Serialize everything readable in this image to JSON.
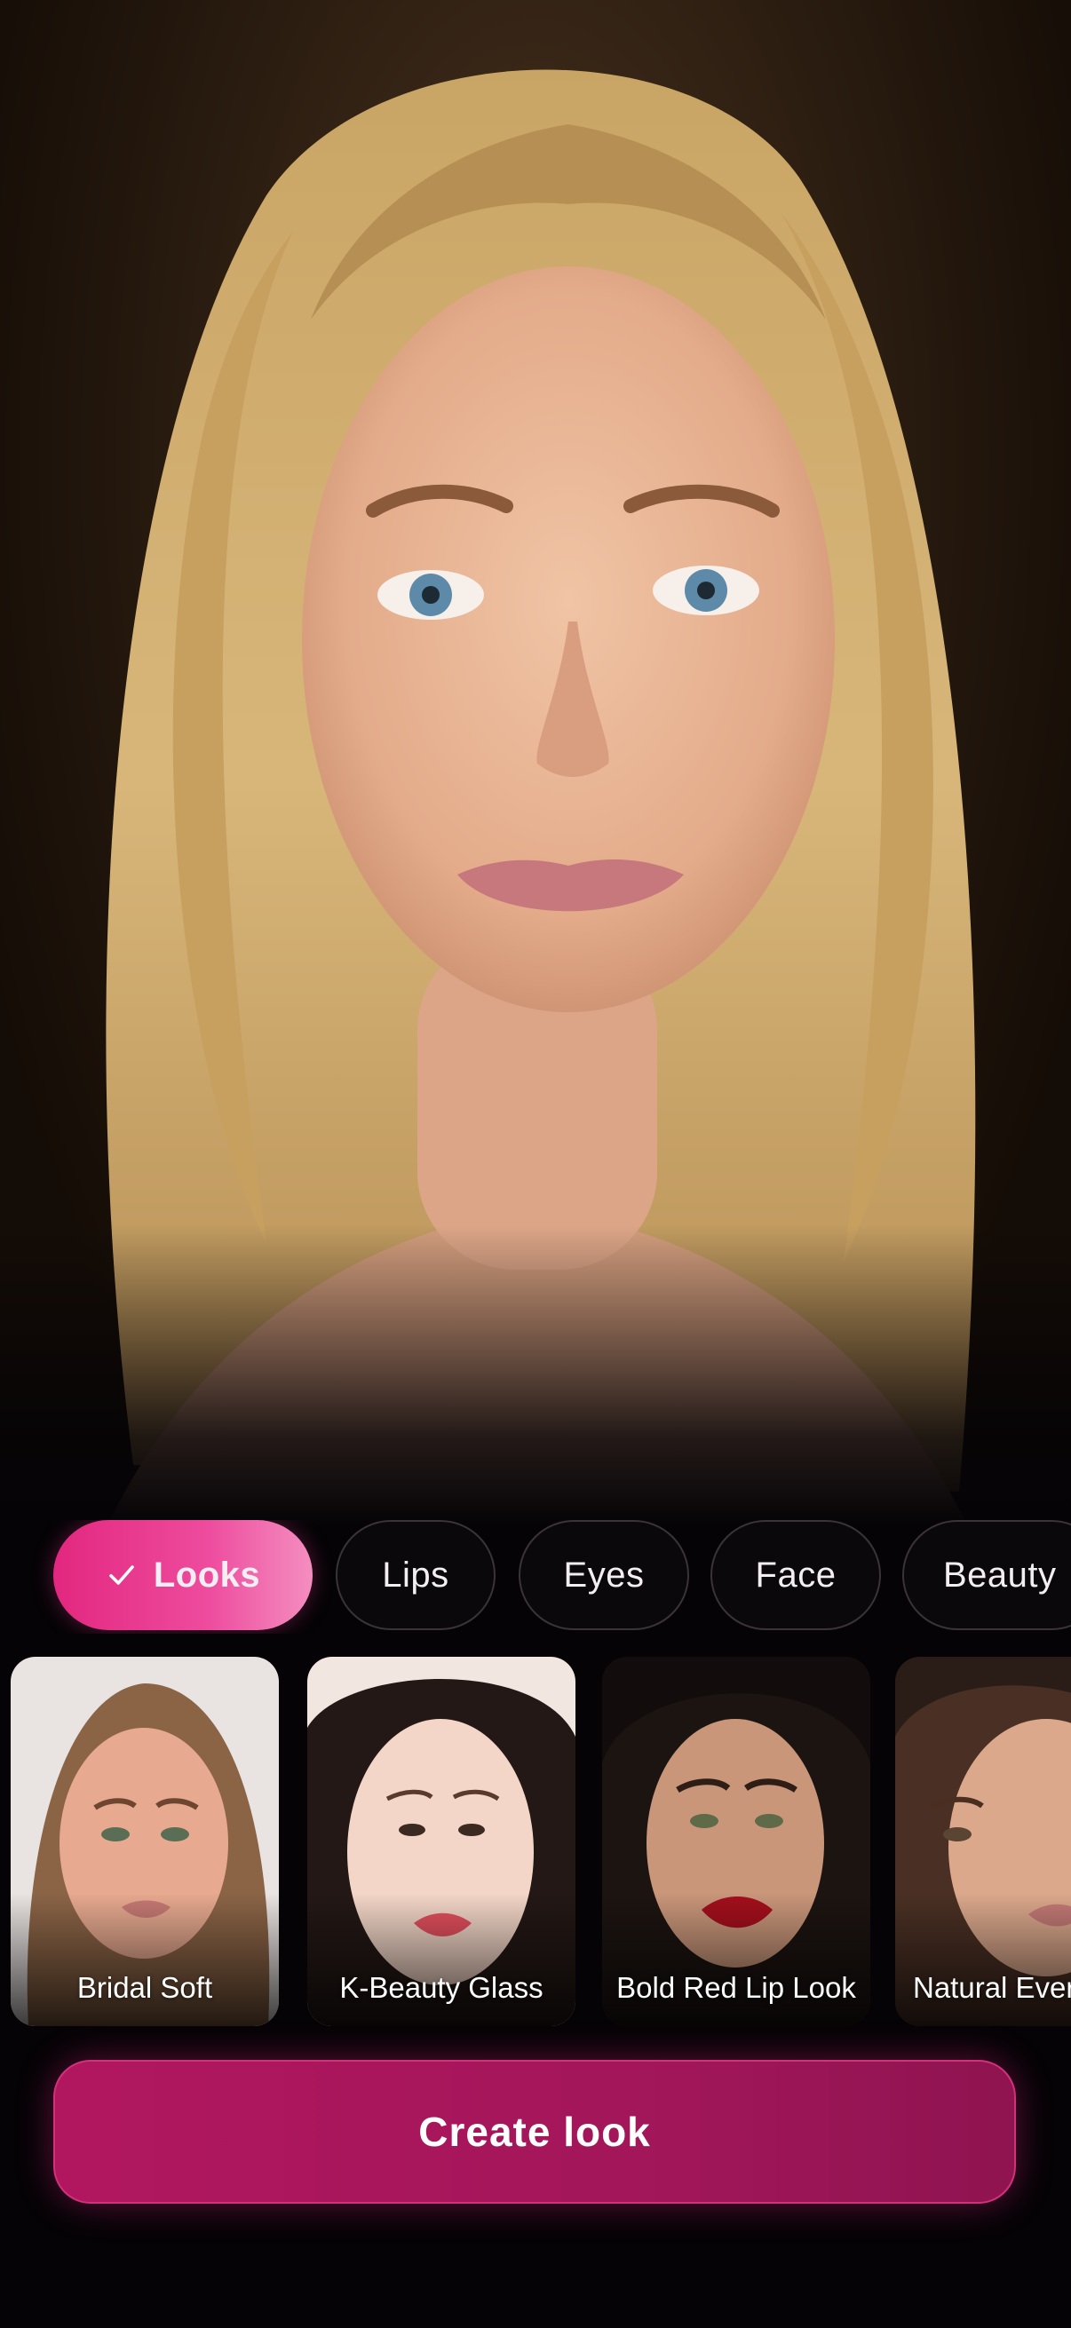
{
  "hero": {
    "icon": "portrait-photo"
  },
  "chips": [
    {
      "label": "Looks",
      "active": true,
      "icon": "check-icon"
    },
    {
      "label": "Lips",
      "active": false
    },
    {
      "label": "Eyes",
      "active": false
    },
    {
      "label": "Face",
      "active": false
    },
    {
      "label": "Beauty",
      "active": false
    }
  ],
  "cards": [
    {
      "label": "Bridal Soft"
    },
    {
      "label": "K-Beauty Glass"
    },
    {
      "label": "Bold Red Lip Look"
    },
    {
      "label": "Natural Every"
    }
  ],
  "cta": {
    "label": "Create look"
  },
  "colors": {
    "accent": "#e2277f",
    "cta": "#a3165a",
    "background": "#050306"
  }
}
